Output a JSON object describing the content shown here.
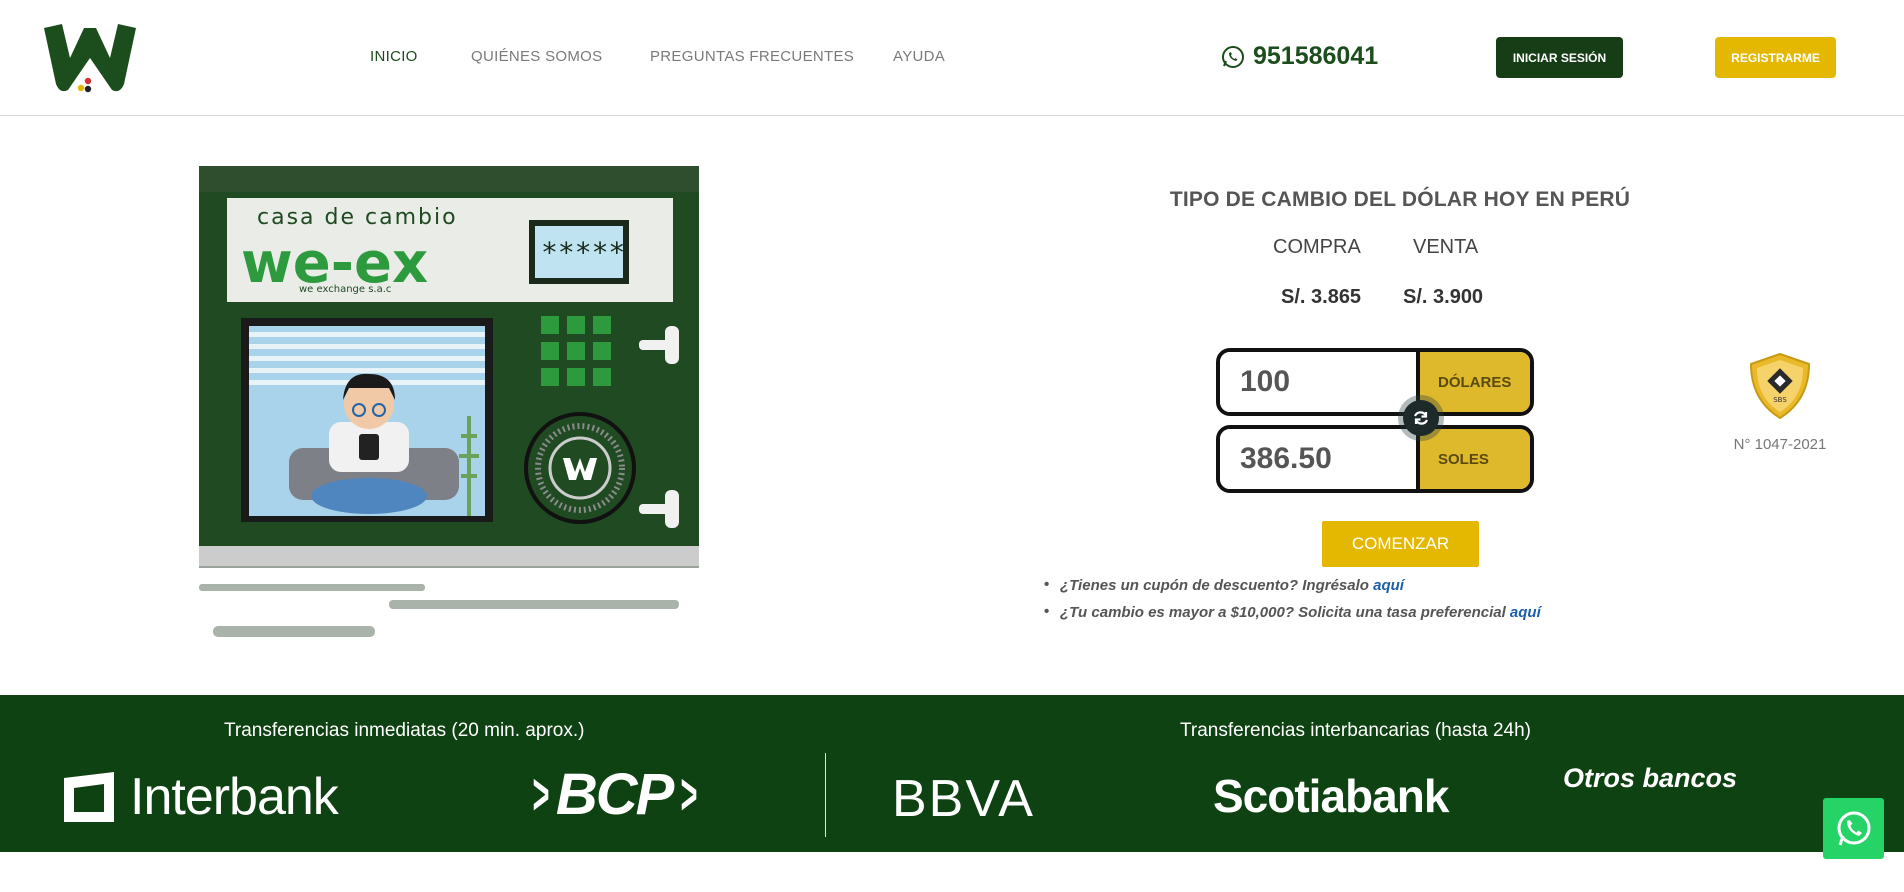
{
  "header": {
    "nav": [
      "INICIO",
      "QUIÉNES SOMOS",
      "PREGUNTAS FRECUENTES",
      "AYUDA"
    ],
    "phone": "951586041",
    "login_label": "INICIAR SESIÓN",
    "register_label": "REGISTRARME"
  },
  "illustration": {
    "sign_line1": "casa de cambio",
    "sign_line2": "we-ex",
    "sign_line3": "we exchange s.a.c",
    "screen_text": "*****"
  },
  "rates": {
    "title": "TIPO DE CAMBIO DEL DÓLAR HOY EN PERÚ",
    "buy_label": "COMPRA",
    "sell_label": "VENTA",
    "buy_value": "S/. 3.865",
    "sell_value": "S/. 3.900"
  },
  "calculator": {
    "send_amount": "100",
    "send_currency": "DÓLARES",
    "receive_amount": "386.50",
    "receive_currency": "SOLES",
    "start_label": "COMENZAR"
  },
  "notes": [
    {
      "text": "¿Tienes un cupón de descuento? Ingrésalo ",
      "link": "aquí"
    },
    {
      "text": "¿Tu cambio es mayor a $10,000? Solicita una tasa preferencial ",
      "link": "aquí"
    }
  ],
  "badge": {
    "label": "N° 1047-2021",
    "seal_text": "SBS"
  },
  "footer": {
    "immediate_caption": "Transferencias inmediatas (20 min. aprox.)",
    "interbank_caption": "Transferencias interbancarias (hasta 24h)",
    "banks": [
      "Interbank",
      "BCP",
      "BBVA",
      "Scotiabank",
      "Otros bancos"
    ]
  },
  "colors": {
    "brand_green": "#0f4212",
    "brand_yellow": "#e4b800",
    "link_blue": "#1c5ea8"
  }
}
